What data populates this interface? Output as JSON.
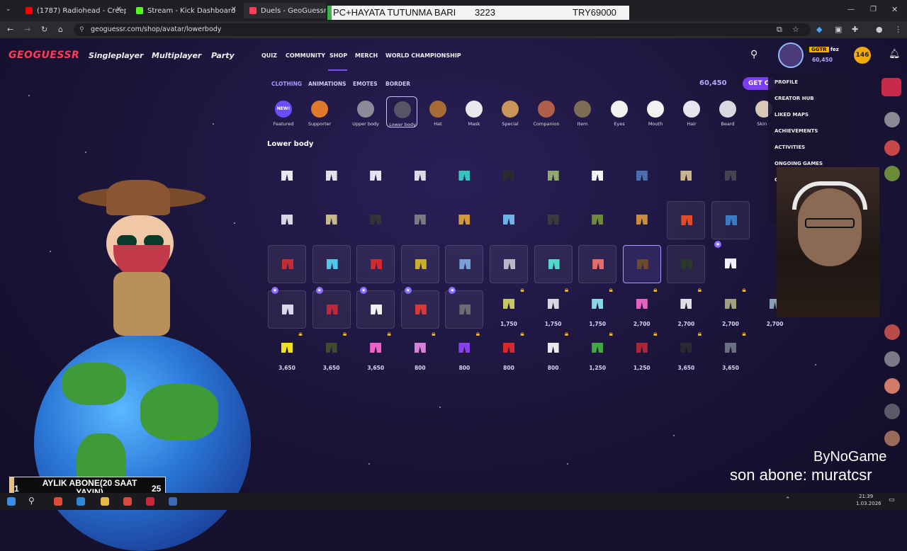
{
  "browser": {
    "tabs": [
      {
        "title": "(1787) Radiohead - Creep - You",
        "color": "#ff0000"
      },
      {
        "title": "Stream - Kick Dashboard",
        "color": "#53fc18"
      },
      {
        "title": "Duels - GeoGuessr",
        "color": "#ff3d58"
      }
    ],
    "url": "geoguessr.com/shop/avatar/lowerbody"
  },
  "alert": {
    "left": "PC+HAYATA TUTUNMA BARI",
    "middle": "3223",
    "right": "TRY69000"
  },
  "site": {
    "logo": "GEOGUESSR",
    "main_nav": [
      "Singleplayer",
      "Multiplayer",
      "Party"
    ],
    "sub_nav": [
      "QUIZ",
      "COMMUNITY",
      "SHOP",
      "MERCH",
      "WORLD CHAMPIONSHIP"
    ],
    "user": {
      "badge": "GGTR",
      "name": "fez",
      "coins": "60,450",
      "level": "146"
    },
    "category_tabs": [
      "CLOTHING",
      "ANIMATIONS",
      "EMOTES",
      "BORDER"
    ],
    "coins": "60,450",
    "get_button": "GET C",
    "categories": [
      {
        "label": "Featured",
        "color": "#6c4cff",
        "icon": "new-badge-icon",
        "badge": "NEW!"
      },
      {
        "label": "Supporter",
        "color": "#e07a2b",
        "icon": "supporter-icon"
      },
      {
        "label": "Upper body",
        "color": "#8b8b99",
        "icon": "upper-body-icon"
      },
      {
        "label": "Lower body",
        "color": "#555566",
        "icon": "lower-body-icon"
      },
      {
        "label": "Hat",
        "color": "#a86b35",
        "icon": "hat-icon"
      },
      {
        "label": "Mask",
        "color": "#e8e8ee",
        "icon": "mask-icon"
      },
      {
        "label": "Special",
        "color": "#c9955a",
        "icon": "special-icon"
      },
      {
        "label": "Companion",
        "color": "#b0604a",
        "icon": "companion-icon"
      },
      {
        "label": "Item",
        "color": "#7d6d55",
        "icon": "item-icon"
      },
      {
        "label": "Eyes",
        "color": "#f2f2f2",
        "icon": "eyes-icon"
      },
      {
        "label": "Mouth",
        "color": "#f2f2f2",
        "icon": "mouth-icon"
      },
      {
        "label": "Hair",
        "color": "#e6e6ee",
        "icon": "hair-icon"
      },
      {
        "label": "Beard",
        "color": "#d8d8e0",
        "icon": "beard-icon"
      },
      {
        "label": "Skin c",
        "color": "#d9c8b8",
        "icon": "skin-icon"
      }
    ],
    "section_title": "Lower body",
    "items": [
      [
        {
          "c": "#e8e8f0"
        },
        {
          "c": "#e0e0ea"
        },
        {
          "c": "#e4e4ee"
        },
        {
          "c": "#dcdce6"
        },
        {
          "c": "#36c3c0"
        },
        {
          "c": "#2a2a30"
        },
        {
          "c": "#8fa86b"
        },
        {
          "c": "#f5f5f5"
        },
        {
          "c": "#4a6fb0"
        },
        {
          "c": "#c8b488"
        },
        {
          "c": "#444450"
        }
      ],
      [
        {
          "c": "#d8d8e4"
        },
        {
          "c": "#c9b98a"
        },
        {
          "c": "#333338"
        },
        {
          "c": "#7a7a80"
        },
        {
          "c": "#d19a3a"
        },
        {
          "c": "#6cb4e6"
        },
        {
          "c": "#3a3a40"
        },
        {
          "c": "#6e8a3a"
        },
        {
          "c": "#c98b3c"
        },
        {
          "c": "#e04b2a",
          "boxed": true
        },
        {
          "c": "#3a7cc8",
          "boxed": true
        }
      ],
      [
        {
          "c": "#c62b33",
          "boxed": true
        },
        {
          "c": "#4ec8e8",
          "boxed": true
        },
        {
          "c": "#d02a2a",
          "boxed": true
        },
        {
          "c": "#c8b02a",
          "boxed": true
        },
        {
          "c": "#7aa0d8",
          "boxed": true
        },
        {
          "c": "#b8b8c8",
          "boxed": true
        },
        {
          "c": "#52d8c8",
          "boxed": true
        },
        {
          "c": "#e86a6a",
          "boxed": true
        },
        {
          "c": "#6b4a2a",
          "sel": true
        },
        {
          "c": "#2a3a2a",
          "boxed": true
        },
        {
          "c": "#f0f0f6",
          "new": true
        }
      ],
      [
        {
          "c": "#d8d8e8",
          "boxed": true,
          "new": true
        },
        {
          "c": "#c0283a",
          "boxed": true,
          "new": true
        },
        {
          "c": "#f0f0f0",
          "boxed": true,
          "new": true
        },
        {
          "c": "#d83a3a",
          "boxed": true,
          "new": true
        },
        {
          "c": "#6b6b70",
          "boxed": true,
          "new": true
        },
        {
          "c": "#c8c860",
          "price": "1,750",
          "lock": true
        },
        {
          "c": "#d8d8e0",
          "price": "1,750",
          "lock": true
        },
        {
          "c": "#8ad4e8",
          "price": "1,750",
          "lock": true
        },
        {
          "c": "#e860c0",
          "price": "2,700",
          "lock": true
        },
        {
          "c": "#e0e0e0",
          "price": "2,700",
          "lock": true
        },
        {
          "c": "#a0a080",
          "price": "2,700",
          "lock": true
        },
        {
          "c": "#8aa0b0",
          "price": "2,700",
          "lock": true
        }
      ],
      [
        {
          "c": "#f0e020",
          "price": "3,650",
          "lock": true
        },
        {
          "c": "#404a30",
          "price": "3,650",
          "lock": true
        },
        {
          "c": "#f060c8",
          "price": "3,650",
          "lock": true
        },
        {
          "c": "#d880d8",
          "price": "800",
          "lock": true
        },
        {
          "c": "#8a40e8",
          "price": "800",
          "lock": true
        },
        {
          "c": "#d82a2a",
          "price": "800",
          "lock": true
        },
        {
          "c": "#e8e8e8",
          "price": "800",
          "lock": true
        },
        {
          "c": "#40a840",
          "price": "1,250",
          "lock": true
        },
        {
          "c": "#a8283a",
          "price": "1,250",
          "lock": true
        },
        {
          "c": "#2a2a30",
          "price": "3,650",
          "lock": true
        },
        {
          "c": "#6a7080",
          "price": "3,650",
          "lock": true
        }
      ]
    ],
    "dropdown": [
      "PROFILE",
      "CREATOR HUB",
      "LIKED MAPS",
      "ACHIEVEMENTS",
      "ACTIVITIES",
      "ONGOING GAMES",
      "GIFT CARDS"
    ]
  },
  "stream": {
    "sub_goal": {
      "left": "1",
      "text": "AYLIK ABONE(20 SAAT YAYIN)",
      "right": "25"
    },
    "brand": "ByNoGame",
    "last_sub": "son abone: muratcsr"
  },
  "taskbar": {
    "time": "21:39",
    "date": "1.03.2026"
  }
}
